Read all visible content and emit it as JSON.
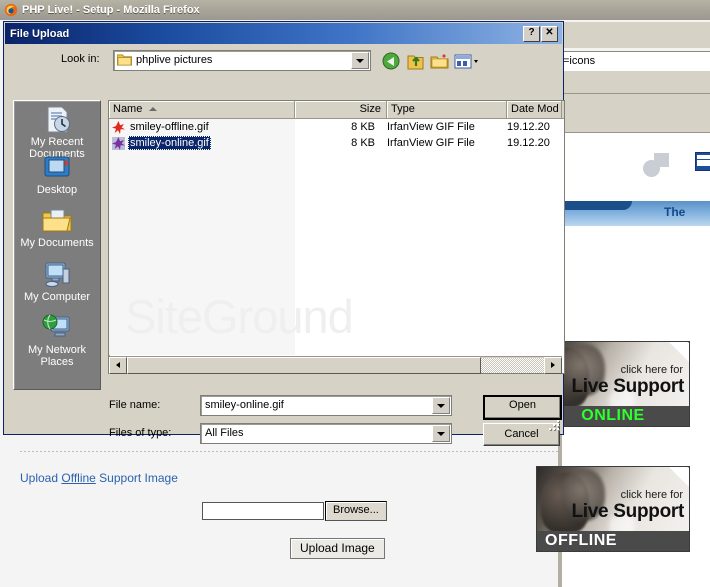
{
  "browser": {
    "title": "PHP Live! - Setup - Mozilla Firefox",
    "url_fragment": "=icons",
    "logo_icon": "firefox-logo-icon"
  },
  "background_page": {
    "watermark": "SiteGround",
    "banner_text": "The",
    "upload_section": {
      "heading_prefix": "Upload ",
      "heading_link": "Offline",
      "heading_suffix": " Support Image",
      "file_value": "",
      "file_placeholder": "",
      "browse_label": "Browse...",
      "upload_label": "Upload Image"
    },
    "banners": [
      {
        "click_for": "click here for",
        "title": "Live Support",
        "status": "ONLINE",
        "status_color": "#2eff2e"
      },
      {
        "click_for": "click here for",
        "title": "Live Support",
        "status": "OFFLINE",
        "status_color": "#ffffff"
      }
    ]
  },
  "dialog": {
    "title": "File Upload",
    "help_button": "?",
    "close_button": "✕",
    "lookin_label": "Look in:",
    "lookin_value": "phplive pictures",
    "toolbar_icons": [
      "back-icon",
      "up-one-level-icon",
      "new-folder-icon",
      "views-icon"
    ],
    "places": [
      {
        "label": "My Recent Documents",
        "icon": "recent-documents-icon"
      },
      {
        "label": "Desktop",
        "icon": "desktop-icon"
      },
      {
        "label": "My Documents",
        "icon": "my-documents-icon"
      },
      {
        "label": "My Computer",
        "icon": "my-computer-icon"
      },
      {
        "label": "My Network Places",
        "icon": "network-places-icon"
      }
    ],
    "columns": [
      "Name",
      "Size",
      "Type",
      "Date Mod"
    ],
    "sort_column": "Name",
    "sort_direction": "ascending",
    "files": [
      {
        "name": "smiley-offline.gif",
        "size": "8 KB",
        "type": "IrfanView GIF File",
        "date": "19.12.20",
        "icon": "gif-file-icon",
        "selected": false
      },
      {
        "name": "smiley-online.gif",
        "size": "8 KB",
        "type": "IrfanView GIF File",
        "date": "19.12.20",
        "icon": "gif-file-icon",
        "selected": true
      }
    ],
    "filename_label": "File name:",
    "filename_value": "smiley-online.gif",
    "filetype_label": "Files of type:",
    "filetype_value": "All Files",
    "open_button": "Open",
    "cancel_button": "Cancel"
  }
}
